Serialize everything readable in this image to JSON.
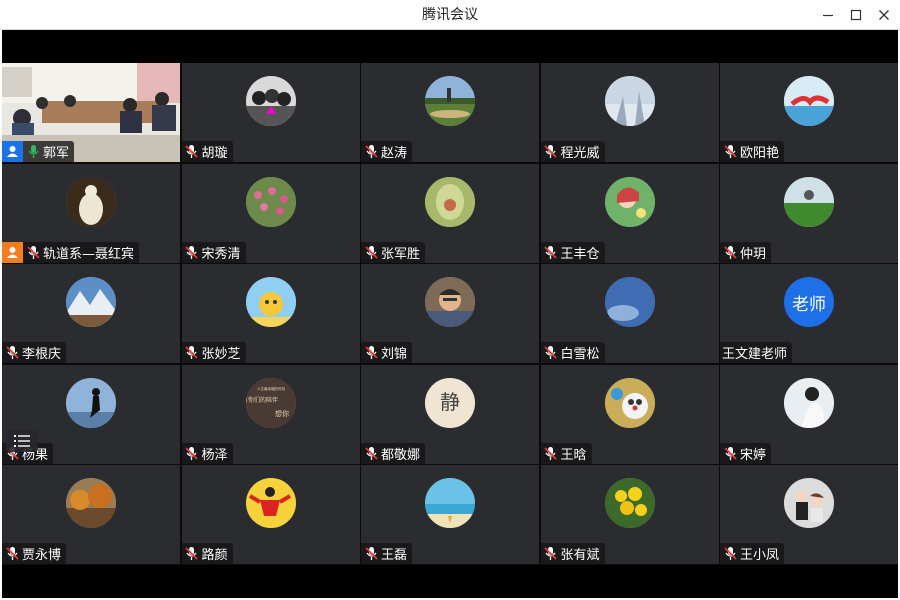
{
  "window": {
    "title": "腾讯会议"
  },
  "participants": [
    {
      "name": "郭军",
      "mic": "on",
      "role": "host",
      "avatar": "video"
    },
    {
      "name": "胡璇",
      "mic": "muted",
      "avatar": "bw-group"
    },
    {
      "name": "赵涛",
      "mic": "muted",
      "avatar": "landscape"
    },
    {
      "name": "程光威",
      "mic": "muted",
      "avatar": "frost"
    },
    {
      "name": "欧阳艳",
      "mic": "muted",
      "avatar": "sky-hands"
    },
    {
      "name": "轨道系—聂红宾",
      "mic": "muted",
      "role": "cohost",
      "avatar": "buddha"
    },
    {
      "name": "宋秀清",
      "mic": "muted",
      "avatar": "flowers"
    },
    {
      "name": "张军胜",
      "mic": "muted",
      "avatar": "painting"
    },
    {
      "name": "王丰仓",
      "mic": "muted",
      "avatar": "anime"
    },
    {
      "name": "仲玥",
      "mic": "muted",
      "avatar": "garden"
    },
    {
      "name": "李根庆",
      "mic": "muted",
      "avatar": "mountains"
    },
    {
      "name": "张妙芝",
      "mic": "muted",
      "avatar": "cartoon-yellow"
    },
    {
      "name": "刘锦",
      "mic": "muted",
      "avatar": "portrait"
    },
    {
      "name": "白雪松",
      "mic": "muted",
      "avatar": "blue-sky"
    },
    {
      "name": "王文建老师",
      "mic": "none",
      "avatar": "text",
      "avatar_text": "老师"
    },
    {
      "name": "杨果",
      "mic": "muted",
      "avatar": "silhouette"
    },
    {
      "name": "杨泽",
      "mic": "muted",
      "avatar": "calligraphy",
      "avatar_text": [
        "人生最幸福的时刻",
        "有你们的陪伴",
        "想你"
      ]
    },
    {
      "name": "都敬娜",
      "mic": "muted",
      "avatar": "jing",
      "avatar_text": "静"
    },
    {
      "name": "王晗",
      "mic": "muted",
      "avatar": "doraemon"
    },
    {
      "name": "宋婷",
      "mic": "muted",
      "avatar": "girl-white"
    },
    {
      "name": "贾永博",
      "mic": "muted",
      "avatar": "autumn"
    },
    {
      "name": "路颜",
      "mic": "muted",
      "avatar": "red-figure"
    },
    {
      "name": "王磊",
      "mic": "muted",
      "avatar": "beach"
    },
    {
      "name": "张有斌",
      "mic": "muted",
      "avatar": "yellow-flowers"
    },
    {
      "name": "王小凤",
      "mic": "muted",
      "avatar": "couple"
    }
  ],
  "colors": {
    "tile": "#2b2c2f",
    "accent": "#1a73e8",
    "cohost": "#f57c1f",
    "active_border": "#2bbd5a",
    "mic_on": "#2bbd5a"
  }
}
